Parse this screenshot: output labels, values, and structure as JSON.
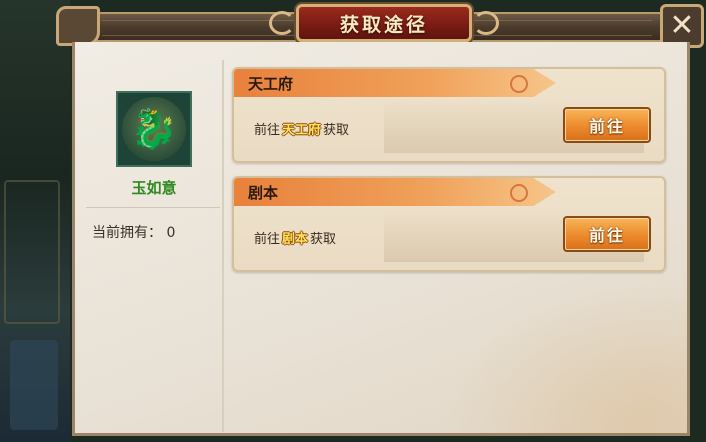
{
  "dialog": {
    "title": "获取途径",
    "close_icon": "close-x"
  },
  "item": {
    "name": "玉如意",
    "icon": "jade-dragon-icon",
    "owned_label": "当前拥有：",
    "owned_count": "0"
  },
  "sources": [
    {
      "title": "天工府",
      "desc_prefix": "前往",
      "desc_target": "天工府",
      "desc_suffix": "获取",
      "button_label": "前往"
    },
    {
      "title": "剧本",
      "desc_prefix": "前往",
      "desc_target": "剧本",
      "desc_suffix": "获取",
      "button_label": "前往"
    }
  ],
  "colors": {
    "accent_orange": "#ec8a2d",
    "item_name_green": "#2f8a22",
    "title_red": "#7b1c14",
    "highlight_yellow": "#ffe35a"
  }
}
